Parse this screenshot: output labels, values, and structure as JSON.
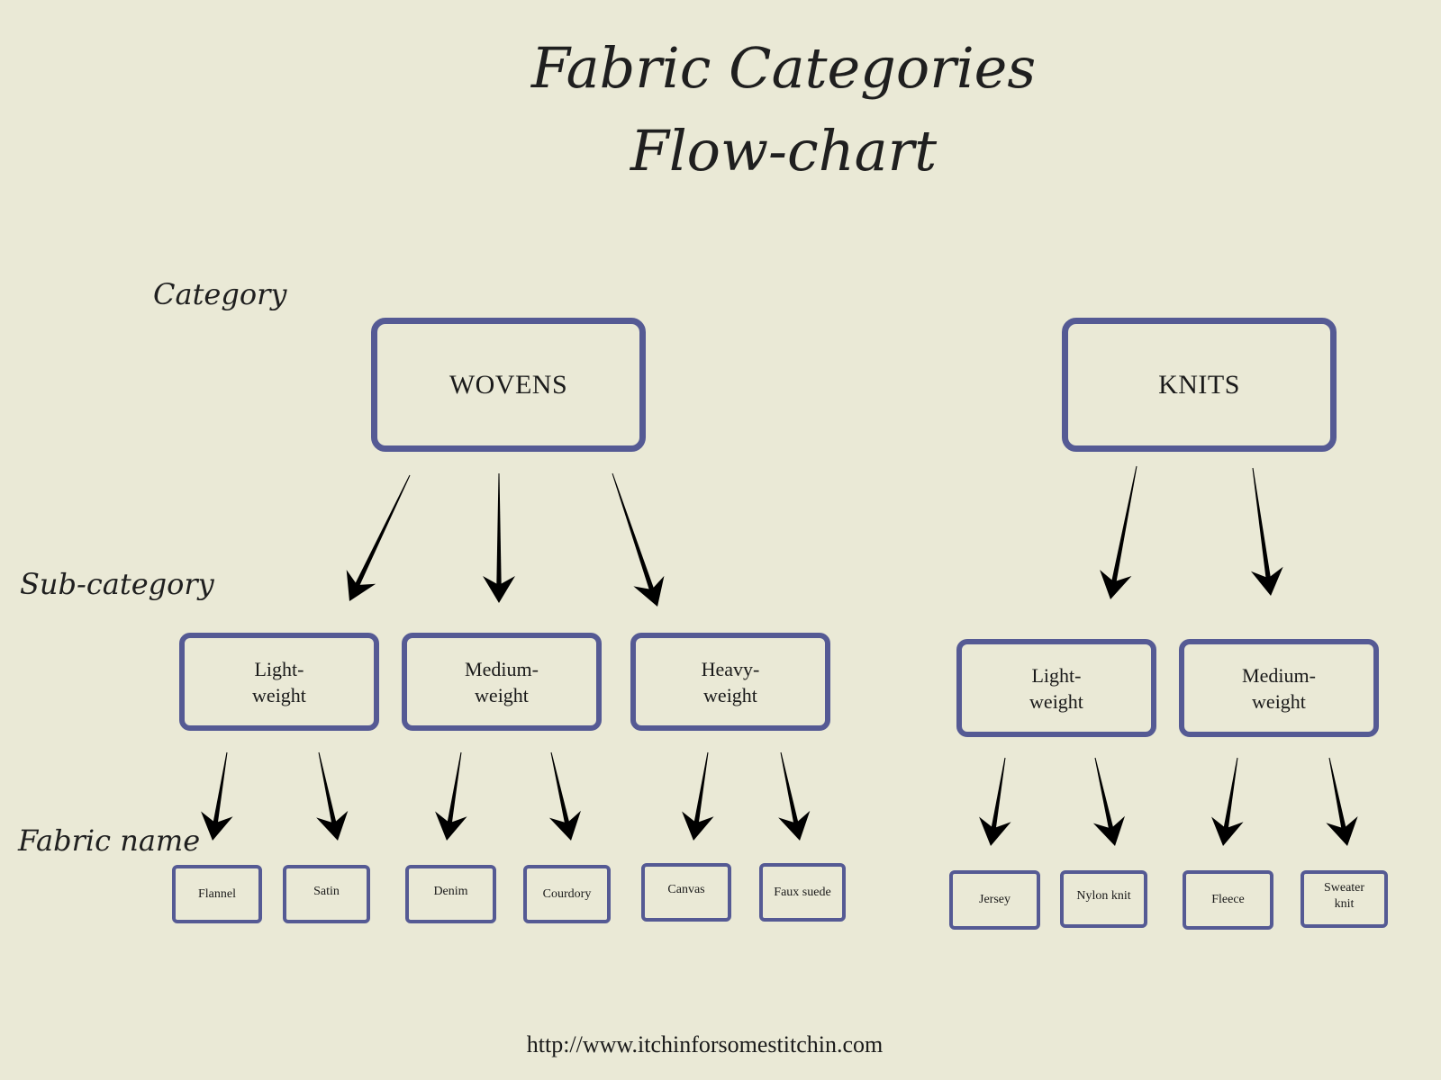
{
  "title": {
    "line1": "Fabric Categories",
    "line2": "Flow-chart"
  },
  "level_labels": {
    "category": "Category",
    "sub_category": "Sub-category",
    "fabric_name": "Fabric name"
  },
  "colors": {
    "background": "#eae9d6",
    "box_border": "#555a94",
    "arrow": "#000000",
    "text": "#1a1a1a"
  },
  "categories": [
    {
      "label": "WOVENS",
      "subcategories": [
        {
          "label_line1": "Light-",
          "label_line2": "weight",
          "fabrics": [
            "Flannel",
            "Satin"
          ]
        },
        {
          "label_line1": "Medium-",
          "label_line2": "weight",
          "fabrics": [
            "Denim",
            "Courdory"
          ]
        },
        {
          "label_line1": "Heavy-",
          "label_line2": "weight",
          "fabrics": [
            "Canvas",
            "Faux suede"
          ]
        }
      ]
    },
    {
      "label": "KNITS",
      "subcategories": [
        {
          "label_line1": "Light-",
          "label_line2": "weight",
          "fabrics": [
            "Jersey",
            "Nylon knit"
          ]
        },
        {
          "label_line1": "Medium-",
          "label_line2": "weight",
          "fabrics": [
            "Fleece",
            "Sweater knit"
          ]
        }
      ]
    }
  ],
  "footer": {
    "url": "http://www.itchinforsomestitchin.com"
  }
}
